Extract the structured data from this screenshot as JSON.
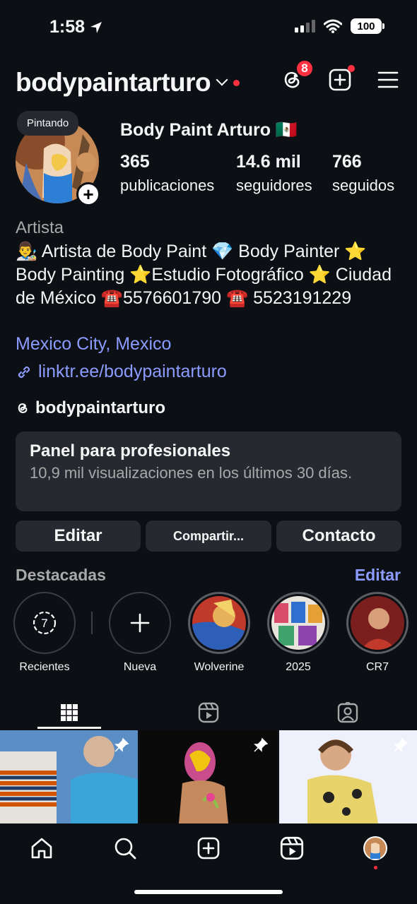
{
  "status_bar": {
    "time": "1:58",
    "battery": "100"
  },
  "header": {
    "username": "bodypaintarturo",
    "threads_badge": "8"
  },
  "profile": {
    "note": "Pintando",
    "display_name": "Body Paint Arturo 🇲🇽",
    "stats": [
      {
        "value": "365",
        "label": "publicaciones"
      },
      {
        "value": "14.6 mil",
        "label": "seguidores"
      },
      {
        "value": "766",
        "label": "seguidos"
      }
    ],
    "category": "Artista",
    "bio": "👨‍🎨 Artista de Body Paint 💎 Body Painter ⭐ Body Painting ⭐Estudio Fotográfico ⭐ Ciudad de México ☎️5576601790 ☎️ 5523191229",
    "location": "Mexico City, Mexico",
    "link": "linktr.ee/bodypaintarturo",
    "threads_handle": "bodypaintarturo"
  },
  "pro_panel": {
    "title": "Panel para profesionales",
    "subtitle": "10,9 mil visualizaciones en los últimos 30 días."
  },
  "buttons": {
    "edit": "Editar",
    "share": "Compartir...",
    "contact": "Contacto"
  },
  "highlights": {
    "title": "Destacadas",
    "edit_label": "Editar",
    "items": [
      {
        "label": "Recientes",
        "count": "7"
      },
      {
        "label": "Nueva"
      },
      {
        "label": "Wolverine"
      },
      {
        "label": "2025"
      },
      {
        "label": "CR7"
      }
    ]
  },
  "colors": {
    "background": "#0c1014",
    "card": "#262a30",
    "link": "#8c9bff",
    "badge": "#ff3040"
  }
}
